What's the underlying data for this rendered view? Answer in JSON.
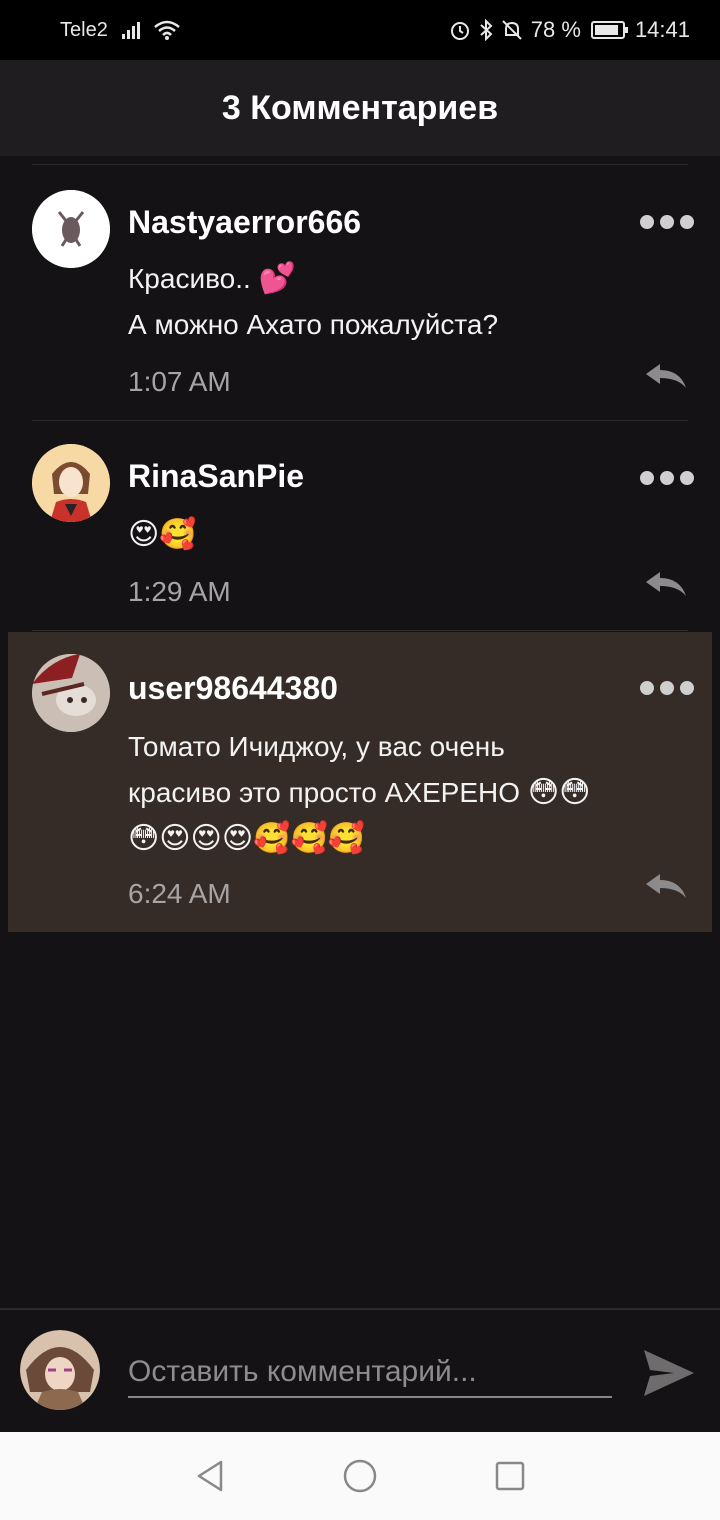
{
  "status_bar": {
    "carrier": "Tele2",
    "battery": "78 %",
    "time": "14:41"
  },
  "header": {
    "title": "3 Комментариев"
  },
  "comments": [
    {
      "username": "Nastyaerror666",
      "text_line1": "Красиво.. ",
      "emoji_line1": "💕",
      "text_line2": "А можно Ахато пожалуйста?",
      "time": "1:07 AM"
    },
    {
      "username": "RinaSanPie",
      "emoji_line1": "😍🥰",
      "time": "1:29 AM"
    },
    {
      "username": "user98644380",
      "text_line1": "Томато Ичиджоу, у вас очень",
      "text_line2": "красиво это просто АХЕРЕНО ",
      "emoji_line2": "😳😳",
      "emoji_line3": "😳😍😍😍🥰🥰🥰",
      "time": "6:24 AM"
    }
  ],
  "input": {
    "placeholder": "Оставить комментарий..."
  },
  "colors": {
    "background": "#141215",
    "header_bg": "#1f1d20",
    "highlight_bg": "#352b27",
    "timestamp": "#a8a4a4"
  }
}
